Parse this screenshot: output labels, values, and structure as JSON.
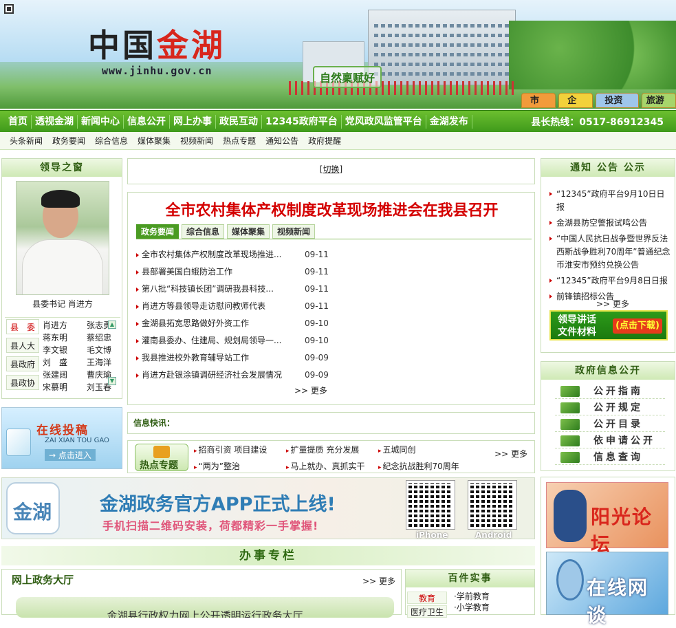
{
  "banner": {
    "logo_black": "中国",
    "logo_red": "金湖",
    "url": "www.jinhu.gov.cn",
    "slogan": "自然稟赋好",
    "roles": [
      "市民",
      "企业",
      "投资者",
      "旅游者"
    ]
  },
  "nav": {
    "items": [
      "首页",
      "透视金湖",
      "新闻中心",
      "信息公开",
      "网上办事",
      "政民互动",
      "12345政府平台",
      "党风政风监管平台",
      "金湖发布"
    ],
    "hotline": "县长热线：0517-86912345"
  },
  "subnav": [
    "头条新闻",
    "政务要闻",
    "综合信息",
    "媒体聚集",
    "视频新闻",
    "热点专题",
    "通知公告",
    "政府提醒"
  ],
  "leader": {
    "title": "领导之窗",
    "caption": "县委书记 肖进方",
    "categories": [
      "县　委",
      "县人大",
      "县政府",
      "县政协"
    ],
    "names": [
      [
        "肖进方",
        "张志勇"
      ],
      [
        "蒋东明",
        "蔡绍忠"
      ],
      [
        "李文银",
        "毛文博"
      ],
      [
        "刘　盛",
        "王海洋"
      ],
      [
        "张建阔",
        "曹庆瑜"
      ],
      [
        "宋慕明",
        "刘玉春"
      ]
    ],
    "scroll_up": "▲",
    "scroll_down": "▼"
  },
  "tougao": {
    "title": "在线投稿",
    "pinyin": "ZAI XIAN TOU GAO",
    "enter": "→ 点击进入"
  },
  "switch": {
    "prefix": "[",
    "label": "切换",
    "suffix": "]"
  },
  "news": {
    "headline": "全市农村集体产权制度改革现场推进会在我县召开",
    "tabs": [
      "政务要闻",
      "综合信息",
      "媒体聚集",
      "视频新闻"
    ],
    "items": [
      {
        "title": "全市农村集体产权制度改革现场推进...",
        "date": "09-11"
      },
      {
        "title": "县部署美国白蛾防治工作",
        "date": "09-11"
      },
      {
        "title": "第八批“科技镇长团”调研我县科技...",
        "date": "09-11"
      },
      {
        "title": "肖进方等县领导走访慰问教师代表",
        "date": "09-11"
      },
      {
        "title": "金湖县拓宽思路做好外资工作",
        "date": "09-10"
      },
      {
        "title": "灌南县委办、住建局、规划局领导一...",
        "date": "09-10"
      },
      {
        "title": "我县推进校外教育辅导站工作",
        "date": "09-09"
      },
      {
        "title": "肖进方赴银涂镇调研经济社会发展情况",
        "date": "09-09"
      }
    ],
    "more": ">> 更多"
  },
  "kuaixun": {
    "label": "信息快讯："
  },
  "hot": {
    "badge": "热点专题",
    "links": [
      "招商引资 项目建设",
      "扩量提质 充分发展",
      "五城同创",
      "“两为”整治",
      "马上就办、真抓实干",
      "纪念抗战胜利70周年"
    ],
    "more": ">> 更多"
  },
  "notice": {
    "title": "通知 公告 公示",
    "items": [
      "“12345”政府平台9月10日日报",
      "金湖县防空警报试鸣公告",
      "“中国人民抗日战争暨世界反法西斯战争胜利70周年”普通纪念币淮安市预约兑换公告",
      "“12345”政府平台9月8日日报",
      "前锋镇招标公告"
    ],
    "more": ">> 更多",
    "download_line1": "领导讲话",
    "download_line2": "文件材料",
    "download_tag": "(点击下载)"
  },
  "govinfo": {
    "title": "政府信息公开",
    "items": [
      "公开指南",
      "公开规定",
      "公开目录",
      "依申请公开",
      "信息查询"
    ]
  },
  "app": {
    "logo_text": "金湖",
    "title": "金湖政务官方APP正式上线!",
    "subtitle": "手机扫描二维码安装，荷都精彩一手掌握!",
    "qr_labels": [
      "iPhone",
      "Android"
    ]
  },
  "banshi": {
    "title": "办事专栏"
  },
  "hall": {
    "title": "网上政务大厅",
    "more": ">> 更多",
    "bar": "金湖县行政权力网上公开透明运行政务大厅"
  },
  "hundred": {
    "title": "百件实事",
    "categories": [
      "教育",
      "医疗卫生"
    ],
    "subs": [
      "·学前教育",
      "·小学教育"
    ]
  },
  "side_banners": {
    "forum": "阳光论坛",
    "talk": "在线网谈"
  },
  "colors": {
    "nav_green": "#3f9a1b",
    "headline_red": "#d40000",
    "panel_border": "#c9ddb9"
  }
}
